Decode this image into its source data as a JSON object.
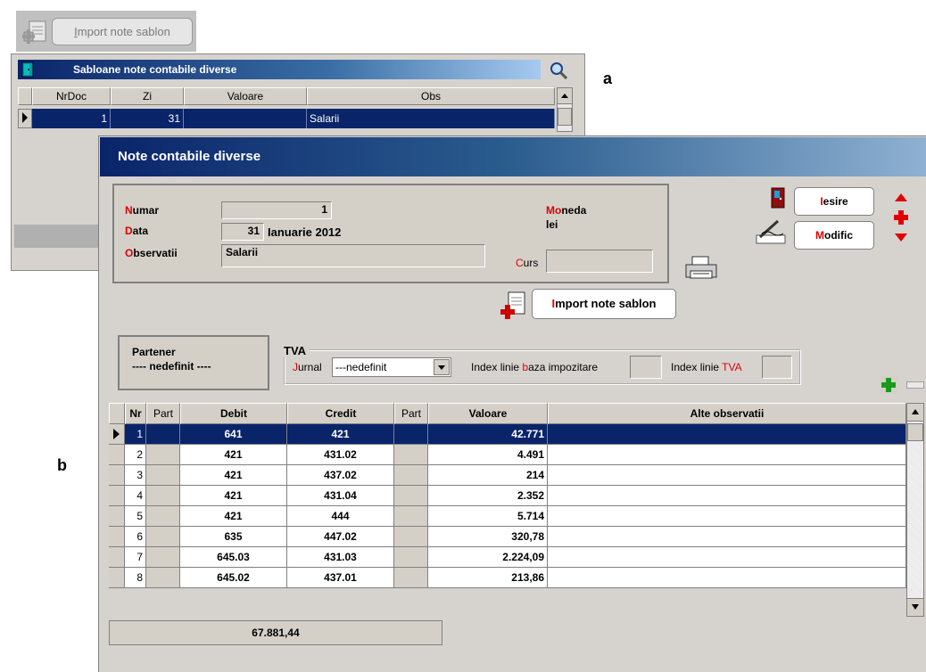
{
  "top_import": {
    "label_u": "I",
    "label_rest": "mport note sablon"
  },
  "panel_a": {
    "title": "Sabloane note contabile diverse",
    "columns": [
      "NrDoc",
      "Zi",
      "Valoare",
      "Obs"
    ],
    "row": {
      "nrdoc": "1",
      "zi": "31",
      "valoare": "",
      "obs": "Salarii"
    },
    "letter": "a"
  },
  "window_b": {
    "title": "Note contabile diverse",
    "letter": "b",
    "numar_r": "N",
    "numar_rest": "umar",
    "numar_val": "1",
    "data_r": "D",
    "data_rest": "ata",
    "data_day": "31",
    "data_text": "Ianuarie 2012",
    "obs_r": "O",
    "obs_rest": "bservatii",
    "obs_val": "Salarii",
    "moneda_r": "Mo",
    "moneda_rest": "neda",
    "moneda_val": "lei",
    "curs_r": "C",
    "curs_rest": "urs",
    "curs_val": "",
    "iesire_r": "I",
    "iesire_rest": "esire",
    "modific_r": "M",
    "modific_rest": "odific",
    "import_r": "I",
    "import_rest": "mport note sablon",
    "partener_label": "Partener",
    "partener_val": "---- nedefinit ----",
    "tva_label": "TVA",
    "jurnal_r": "J",
    "jurnal_rest": "urnal",
    "jurnal_val": "---nedefinit",
    "idx_baza_a": "Index linie ",
    "idx_baza_r": "b",
    "idx_baza_b": "aza impozitare",
    "idx_tva_a": "Index linie ",
    "idx_tva_r": "TVA",
    "columns": [
      "Nr",
      "Part",
      "Debit",
      "Credit",
      "Part",
      "Valoare",
      "Alte observatii"
    ],
    "rows": [
      {
        "nr": "1",
        "debit": "641",
        "credit": "421",
        "valoare": "42.771"
      },
      {
        "nr": "2",
        "debit": "421",
        "credit": "431.02",
        "valoare": "4.491"
      },
      {
        "nr": "3",
        "debit": "421",
        "credit": "437.02",
        "valoare": "214"
      },
      {
        "nr": "4",
        "debit": "421",
        "credit": "431.04",
        "valoare": "2.352"
      },
      {
        "nr": "5",
        "debit": "421",
        "credit": "444",
        "valoare": "5.714"
      },
      {
        "nr": "6",
        "debit": "635",
        "credit": "447.02",
        "valoare": "320,78"
      },
      {
        "nr": "7",
        "debit": "645.03",
        "credit": "431.03",
        "valoare": "2.224,09"
      },
      {
        "nr": "8",
        "debit": "645.02",
        "credit": "437.01",
        "valoare": "213,86"
      }
    ],
    "total": "67.881,44"
  },
  "colors": {
    "selection": "#0a246a",
    "accent_red": "#dd0000",
    "panel": "#d4d0c8"
  }
}
